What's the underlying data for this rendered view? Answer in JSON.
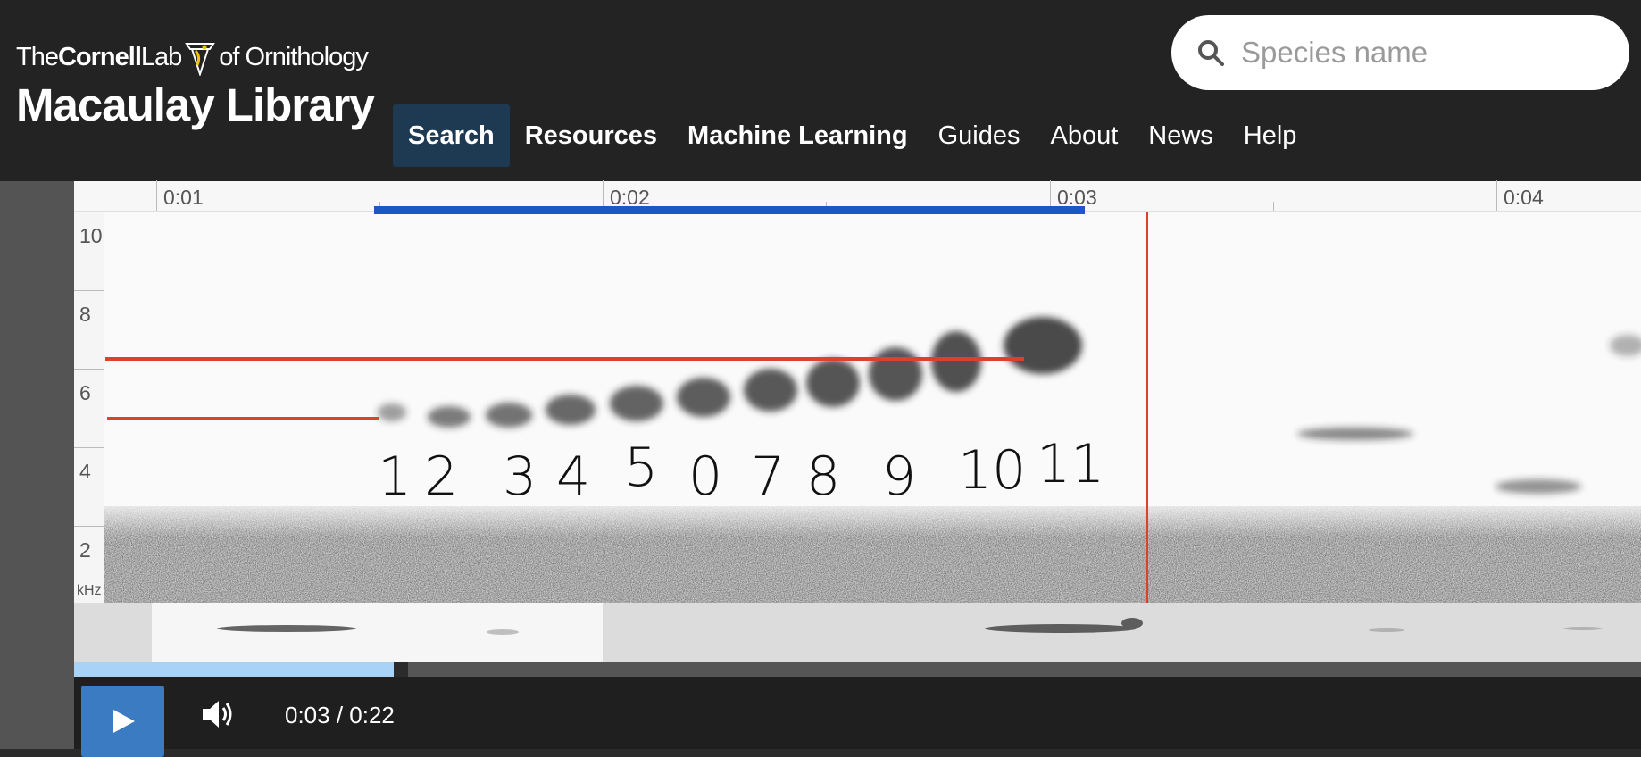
{
  "brand": {
    "line1_prefix": "The",
    "line1_bold": "Cornell",
    "line1_mid": "Lab",
    "line1_suffix": "of Ornithology",
    "line2": "Macaulay Library"
  },
  "search": {
    "placeholder": "Species name",
    "icon": "search-icon"
  },
  "nav": {
    "items": [
      {
        "label": "Search",
        "active": true
      },
      {
        "label": "Resources"
      },
      {
        "label": "Machine Learning"
      },
      {
        "label": "Guides"
      },
      {
        "label": "About"
      },
      {
        "label": "News"
      },
      {
        "label": "Help"
      }
    ]
  },
  "timeline": {
    "labels": [
      "0:01",
      "0:02",
      "0:03",
      "0:04"
    ]
  },
  "spectrogram": {
    "freq_labels": [
      "10",
      "8",
      "6",
      "4",
      "2"
    ],
    "unit": "kHz",
    "annotations": [
      "1",
      "2",
      "3",
      "4",
      "5",
      "0",
      "7",
      "8",
      "9",
      "10",
      "11"
    ]
  },
  "player": {
    "current_time": "0:03",
    "separator": " / ",
    "duration": "0:22",
    "time_display": "0:03 / 0:22",
    "progress_fraction": 0.136
  },
  "colors": {
    "header_bg": "#232323",
    "nav_active_bg": "#1d3a52",
    "selection": "#1f55c4",
    "marker_red": "#d9432b",
    "play_button": "#3a7bc1",
    "progress_fill": "#a8d3f7"
  }
}
